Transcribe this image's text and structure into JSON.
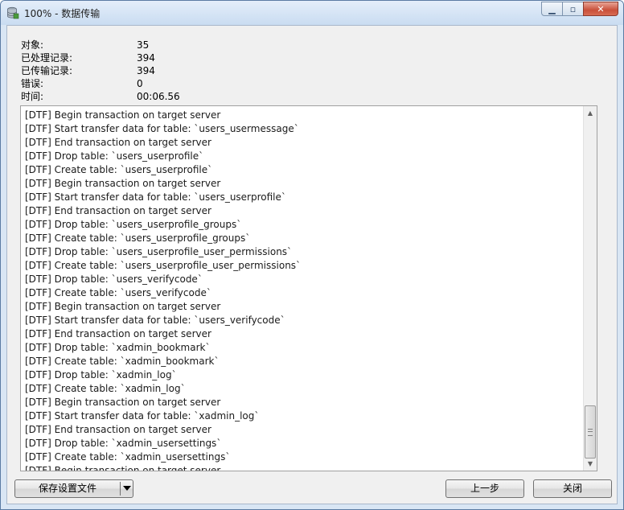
{
  "window": {
    "title": "100% - 数据传输",
    "icon": "database-icon",
    "minimize_icon": "minimize-icon",
    "maximize_icon": "maximize-icon",
    "close_icon": "close-icon"
  },
  "stats": [
    {
      "label": "对象:",
      "value": "35"
    },
    {
      "label": "已处理记录:",
      "value": "394"
    },
    {
      "label": "已传输记录:",
      "value": "394"
    },
    {
      "label": "错误:",
      "value": "0"
    },
    {
      "label": "时间:",
      "value": "00:06.56"
    }
  ],
  "log": [
    "[DTF] Begin transaction on target server",
    "[DTF] Start transfer data for table: `users_usermessage`",
    "[DTF] End transaction on target server",
    "[DTF] Drop table: `users_userprofile`",
    "[DTF] Create table: `users_userprofile`",
    "[DTF] Begin transaction on target server",
    "[DTF] Start transfer data for table: `users_userprofile`",
    "[DTF] End transaction on target server",
    "[DTF] Drop table: `users_userprofile_groups`",
    "[DTF] Create table: `users_userprofile_groups`",
    "[DTF] Drop table: `users_userprofile_user_permissions`",
    "[DTF] Create table: `users_userprofile_user_permissions`",
    "[DTF] Drop table: `users_verifycode`",
    "[DTF] Create table: `users_verifycode`",
    "[DTF] Begin transaction on target server",
    "[DTF] Start transfer data for table: `users_verifycode`",
    "[DTF] End transaction on target server",
    "[DTF] Drop table: `xadmin_bookmark`",
    "[DTF] Create table: `xadmin_bookmark`",
    "[DTF] Drop table: `xadmin_log`",
    "[DTF] Create table: `xadmin_log`",
    "[DTF] Begin transaction on target server",
    "[DTF] Start transfer data for table: `xadmin_log`",
    "[DTF] End transaction on target server",
    "[DTF] Drop table: `xadmin_usersettings`",
    "[DTF] Create table: `xadmin_usersettings`",
    "[DTF] Begin transaction on target server"
  ],
  "buttons": {
    "save": "保存设置文件",
    "prev": "上一步",
    "close": "关闭"
  }
}
